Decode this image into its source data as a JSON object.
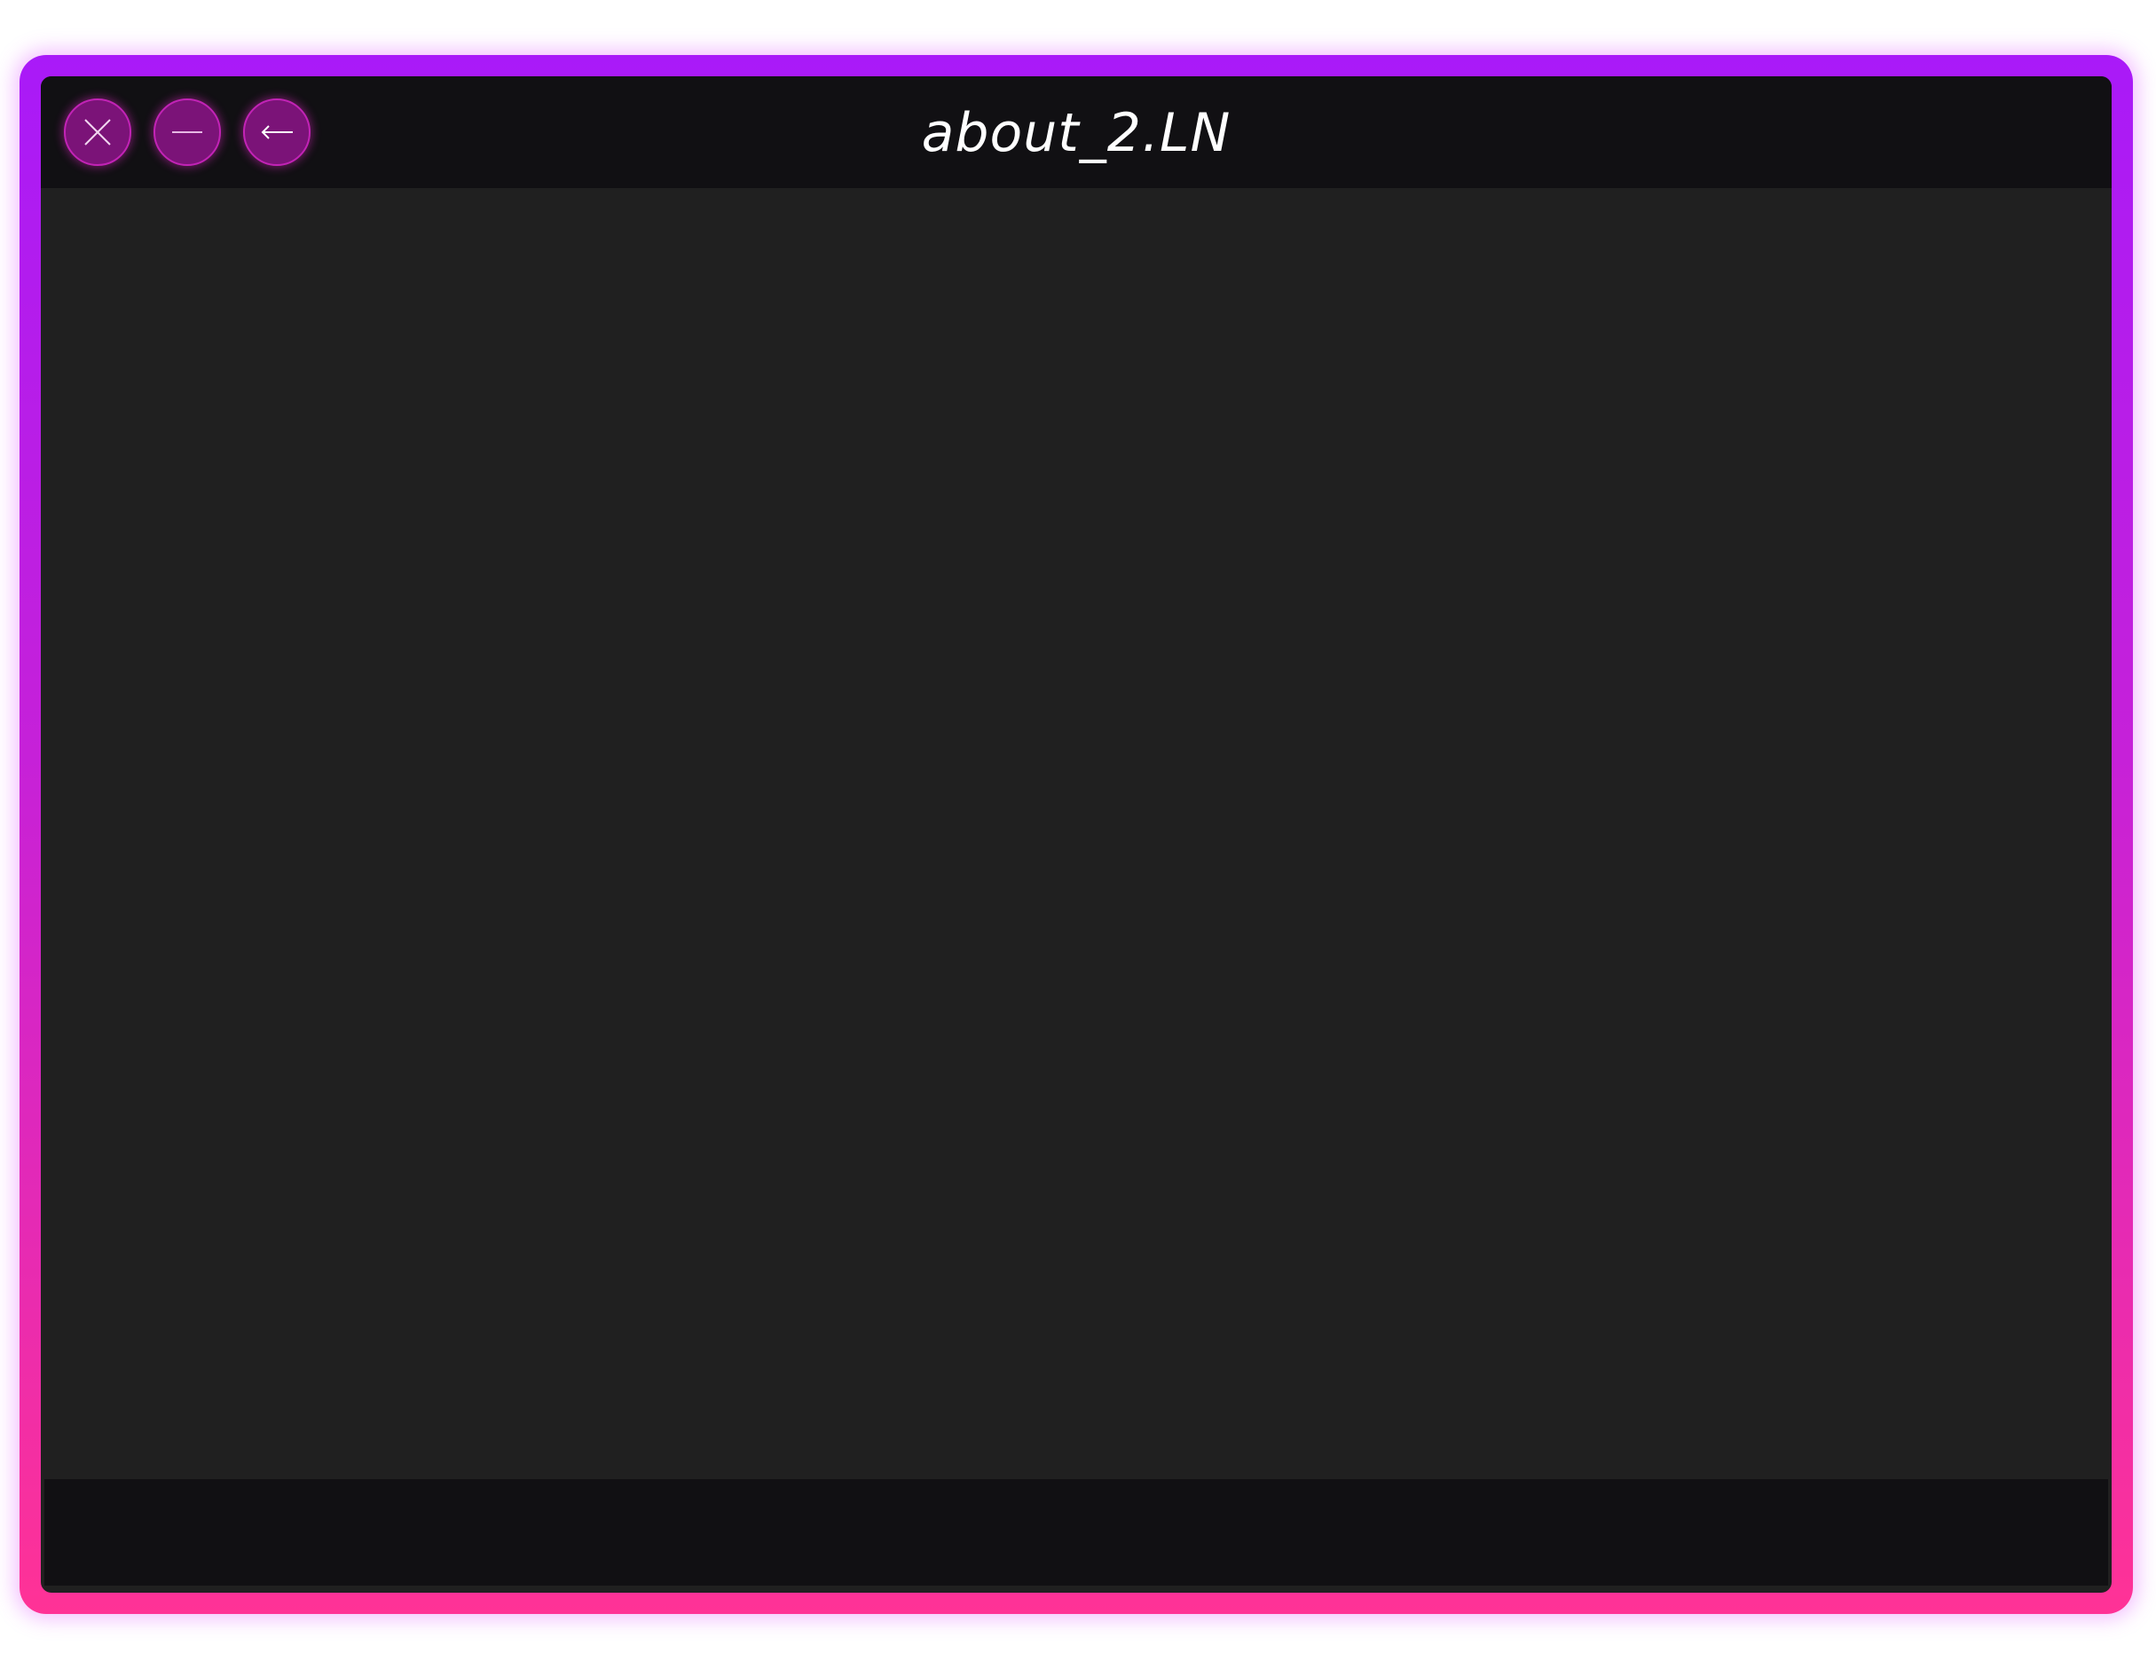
{
  "window": {
    "title": "about_2.LN"
  },
  "controls": {
    "close_icon": "close-icon",
    "minimize_icon": "minimize-icon",
    "back_icon": "back-arrow-icon"
  },
  "colors": {
    "frame_top": "#a91af8",
    "frame_bottom": "#ff3296",
    "titlebar": "#111013",
    "content": "#202020",
    "button_fill": "#7b1378",
    "button_border": "#c223b6"
  }
}
